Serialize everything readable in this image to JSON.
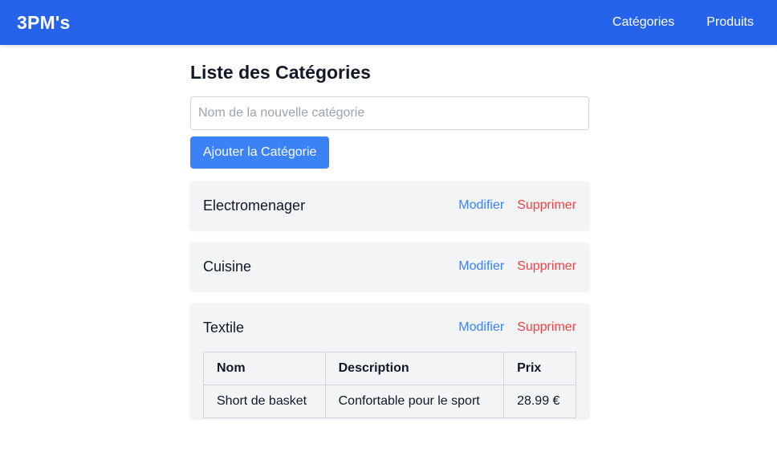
{
  "navbar": {
    "brand": "3PM's",
    "links": [
      "Catégories",
      "Produits"
    ]
  },
  "page": {
    "title": "Liste des Catégories",
    "input_placeholder": "Nom de la nouvelle catégorie",
    "add_button": "Ajouter la Catégorie"
  },
  "categories": [
    {
      "name": "Electromenager",
      "edit": "Modifier",
      "delete": "Supprimer"
    },
    {
      "name": "Cuisine",
      "edit": "Modifier",
      "delete": "Supprimer"
    },
    {
      "name": "Textile",
      "edit": "Modifier",
      "delete": "Supprimer",
      "table": {
        "headers": [
          "Nom",
          "Description",
          "Prix"
        ],
        "rows": [
          [
            "Short de basket",
            "Confortable pour le sport",
            "28.99 €"
          ]
        ]
      }
    }
  ],
  "colors": {
    "navbar": "#2563eb",
    "button": "#3b82f6",
    "edit_link": "#3b82f6",
    "delete_link": "#ef4444",
    "card_bg": "#f3f4f6"
  }
}
